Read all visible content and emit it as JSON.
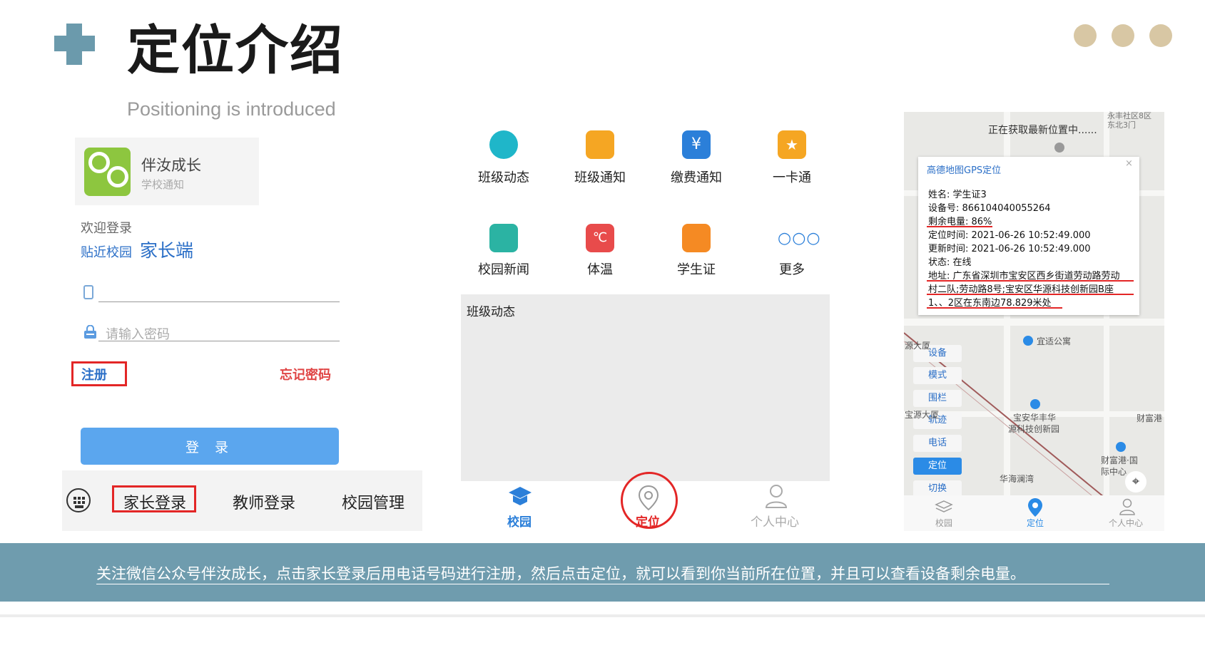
{
  "header": {
    "title": "定位介绍",
    "subtitle": "Positioning is introduced"
  },
  "login_panel": {
    "app_name": "伴汝成长",
    "app_sub": "学校通知",
    "welcome": "欢迎登录",
    "slogan_a": "贴近校园",
    "slogan_b": "家长端",
    "password_placeholder": "请输入密码",
    "register": "注册",
    "forgot": "忘记密码",
    "login_button": "登 录",
    "tabs": [
      "家长登录",
      "教师登录",
      "校园管理"
    ]
  },
  "home_panel": {
    "grid": [
      {
        "label": "班级动态",
        "icon": "camera-lens-icon",
        "color": "#1fb6c9"
      },
      {
        "label": "班级通知",
        "icon": "speaker-icon",
        "color": "#f5a623"
      },
      {
        "label": "缴费通知",
        "icon": "yen-icon",
        "color": "#2b7fd9"
      },
      {
        "label": "一卡通",
        "icon": "star-card-icon",
        "color": "#f5a623"
      },
      {
        "label": "校园新闻",
        "icon": "news-icon",
        "color": "#2bb3a3"
      },
      {
        "label": "体温",
        "icon": "thermometer-icon",
        "color": "#e84b4b"
      },
      {
        "label": "学生证",
        "icon": "id-card-icon",
        "color": "#f58a23"
      },
      {
        "label": "更多",
        "icon": "more-dots-icon",
        "color": "#2b7fd9"
      }
    ],
    "feed_title": "班级动态",
    "nav": [
      {
        "label": "校园",
        "icon": "campus-icon",
        "color": "#2b7fd9"
      },
      {
        "label": "定位",
        "icon": "location-pin-icon",
        "color": "#e84b4b"
      },
      {
        "label": "个人中心",
        "icon": "person-icon",
        "color": "#aaaaaa"
      }
    ]
  },
  "map_panel": {
    "fetching": "正在获取最新位置中......",
    "top_right": [
      "永丰社区8区",
      "东北3门"
    ],
    "popup_head": "高德地图GPS定位",
    "popup_lines": [
      "姓名: 学生证3",
      "设备号: 866104040055264",
      "剩余电量: 86%",
      "定位时间: 2021-06-26 10:52:49.000",
      "更新时间: 2021-06-26 10:52:49.000",
      "状态: 在线",
      "地址: 广东省深圳市宝安区西乡街道劳动路劳动",
      "村二队;劳动路8号;宝安区华源科技创新园B座",
      "1、、2区在东南边78.829米处"
    ],
    "side_buttons": [
      "设备",
      "模式",
      "围栏",
      "轨迹",
      "电话",
      "定位",
      "切换"
    ],
    "pois": [
      "宜适公寓",
      "源大厦",
      "宝源大厦",
      "宝安华丰华",
      "源科技创新园",
      "华海澜湾",
      "财富港·国",
      "际中心",
      "财富港"
    ],
    "nav": [
      "校园",
      "定位",
      "个人中心"
    ]
  },
  "banner": {
    "text": "关注微信公众号伴汝成长，点击家长登录后用电话号码进行注册，然后点击定位，就可以看到你当前所在位置，并且可以查看设备剩余电量。"
  }
}
